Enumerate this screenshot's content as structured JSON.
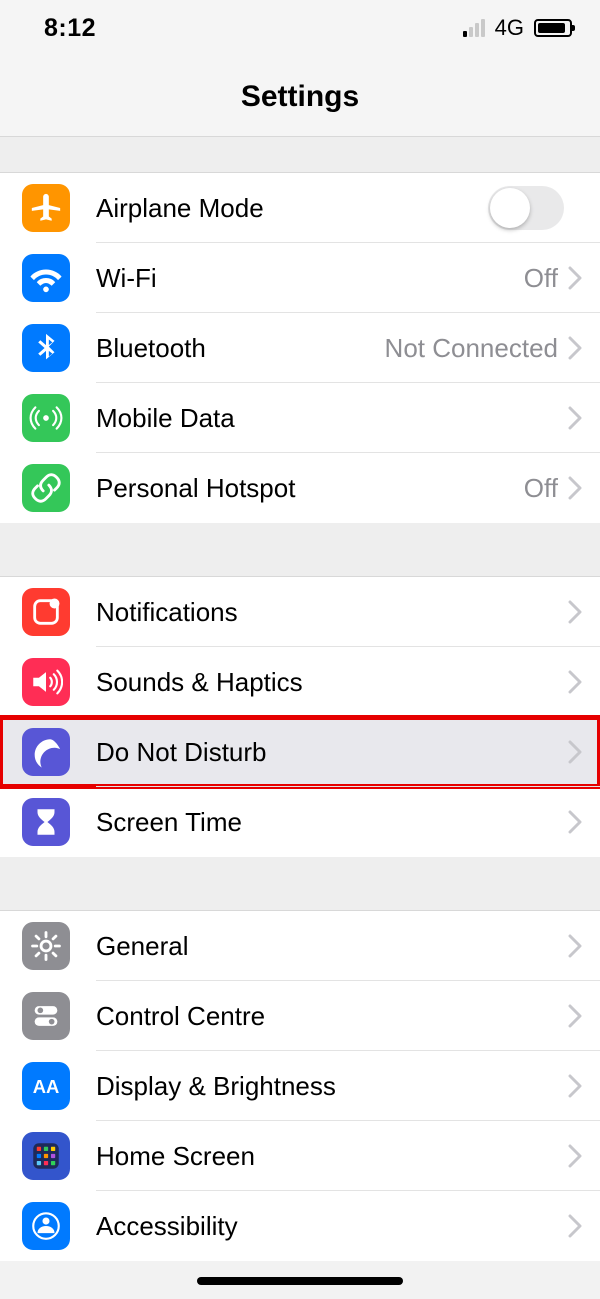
{
  "status": {
    "time": "8:12",
    "network": "4G"
  },
  "header": {
    "title": "Settings"
  },
  "groups": [
    {
      "rows": [
        {
          "key": "airplane",
          "label": "Airplane Mode",
          "icon": "airplane",
          "bg": "#ff9500",
          "type": "switch",
          "on": false
        },
        {
          "key": "wifi",
          "label": "Wi-Fi",
          "icon": "wifi",
          "bg": "#007aff",
          "type": "nav",
          "detail": "Off"
        },
        {
          "key": "bluetooth",
          "label": "Bluetooth",
          "icon": "bluetooth",
          "bg": "#007aff",
          "type": "nav",
          "detail": "Not Connected"
        },
        {
          "key": "mobiledata",
          "label": "Mobile Data",
          "icon": "antenna",
          "bg": "#34c759",
          "type": "nav"
        },
        {
          "key": "hotspot",
          "label": "Personal Hotspot",
          "icon": "link",
          "bg": "#34c759",
          "type": "nav",
          "detail": "Off"
        }
      ]
    },
    {
      "rows": [
        {
          "key": "notifications",
          "label": "Notifications",
          "icon": "notify",
          "bg": "#ff3b30",
          "type": "nav"
        },
        {
          "key": "sounds",
          "label": "Sounds & Haptics",
          "icon": "speaker",
          "bg": "#ff2d55",
          "type": "nav"
        },
        {
          "key": "dnd",
          "label": "Do Not Disturb",
          "icon": "moon",
          "bg": "#5856d6",
          "type": "nav",
          "highlight": true
        },
        {
          "key": "screentime",
          "label": "Screen Time",
          "icon": "hourglass",
          "bg": "#5856d6",
          "type": "nav"
        }
      ]
    },
    {
      "rows": [
        {
          "key": "general",
          "label": "General",
          "icon": "gear",
          "bg": "#8e8e93",
          "type": "nav"
        },
        {
          "key": "controlcentre",
          "label": "Control Centre",
          "icon": "switches",
          "bg": "#8e8e93",
          "type": "nav"
        },
        {
          "key": "display",
          "label": "Display & Brightness",
          "icon": "aa",
          "bg": "#007aff",
          "type": "nav"
        },
        {
          "key": "homescreen",
          "label": "Home Screen",
          "icon": "grid",
          "bg": "#3355cc",
          "type": "nav"
        },
        {
          "key": "accessibility",
          "label": "Accessibility",
          "icon": "person",
          "bg": "#007aff",
          "type": "nav"
        }
      ]
    }
  ]
}
